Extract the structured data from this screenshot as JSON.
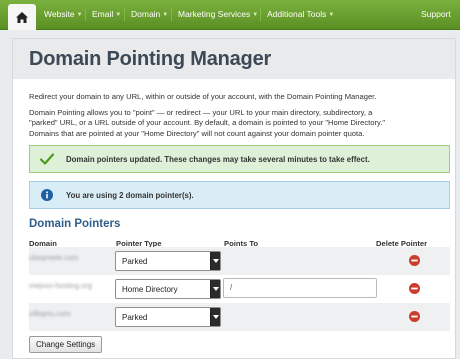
{
  "nav": {
    "items": [
      {
        "label": "Website",
        "has_caret": true
      },
      {
        "label": "Email",
        "has_caret": true
      },
      {
        "label": "Domain",
        "has_caret": true
      },
      {
        "label": "Marketing Services",
        "has_caret": true
      },
      {
        "label": "Additional Tools",
        "has_caret": true
      }
    ],
    "support_label": "Support",
    "home_icon": "home-icon"
  },
  "page": {
    "title": "Domain Pointing Manager",
    "intro": "Redirect your domain to any URL, within or outside of your account, with the Domain Pointing Manager.",
    "explanation": [
      "Domain Pointing allows you to \"point\" — or redirect — your URL to your main directory, subdirectory, a",
      "\"parked\" URL, or a URL outside of your account. By default, a domain is pointed to your \"Home Directory.\"",
      "Domains that are pointed at your \"Home Directory\" will not count against your domain pointer quota."
    ]
  },
  "alerts": {
    "success": "Domain pointers updated. These changes may take several minutes to take effect.",
    "info": "You are using 2 domain pointer(s)."
  },
  "pointers": {
    "section_title": "Domain Pointers",
    "headers": {
      "domain": "Domain",
      "pointer_type": "Pointer Type",
      "points_to": "Points To",
      "delete": "Delete Pointer"
    },
    "rows": [
      {
        "domain": "cbsqmiele.com",
        "pointer_type": "Parked",
        "points_to": null
      },
      {
        "domain": "mejovo-hosting.org",
        "pointer_type": "Home Directory",
        "points_to": "/"
      },
      {
        "domain": "vilbqmu.com",
        "pointer_type": "Parked",
        "points_to": null
      }
    ],
    "submit_label": "Change Settings"
  },
  "colors": {
    "nav_green": "#6aa030",
    "title_text": "#3d4a55",
    "section_blue": "#2f5f8a",
    "success_bg": "#dff0d8",
    "info_bg": "#d9edf7",
    "delete_red": "#cc3b2f"
  }
}
